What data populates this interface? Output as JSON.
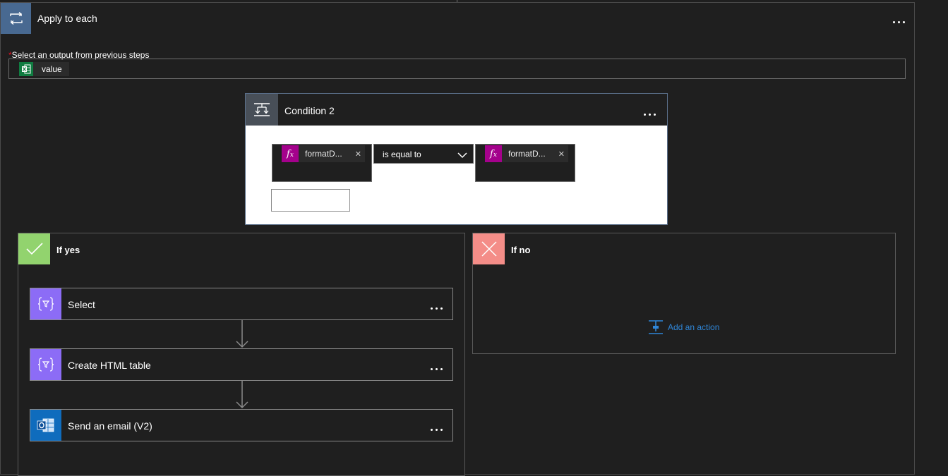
{
  "apply_to_each": {
    "title": "Apply to each",
    "output_label_required": "*",
    "output_label": "Select an output from previous steps",
    "value_token": "value"
  },
  "condition": {
    "title": "Condition 2",
    "left_expression": "formatD...",
    "operator": "is equal to",
    "right_expression": "formatD..."
  },
  "if_yes": {
    "title": "If yes",
    "actions": [
      {
        "title": "Select",
        "icon": "data-operation-icon"
      },
      {
        "title": "Create HTML table",
        "icon": "data-operation-icon"
      },
      {
        "title": "Send an email (V2)",
        "icon": "outlook-icon"
      }
    ]
  },
  "if_no": {
    "title": "If no",
    "add_action": "Add an action"
  },
  "colors": {
    "apply_icon_bg": "#486991",
    "fx_token": "#a4018c",
    "yes_green": "#92d36e",
    "no_red": "#f48d88",
    "data_op_purple": "#8c6cf6",
    "outlook_blue": "#0f6cbd",
    "link_blue": "#2f86d8"
  }
}
